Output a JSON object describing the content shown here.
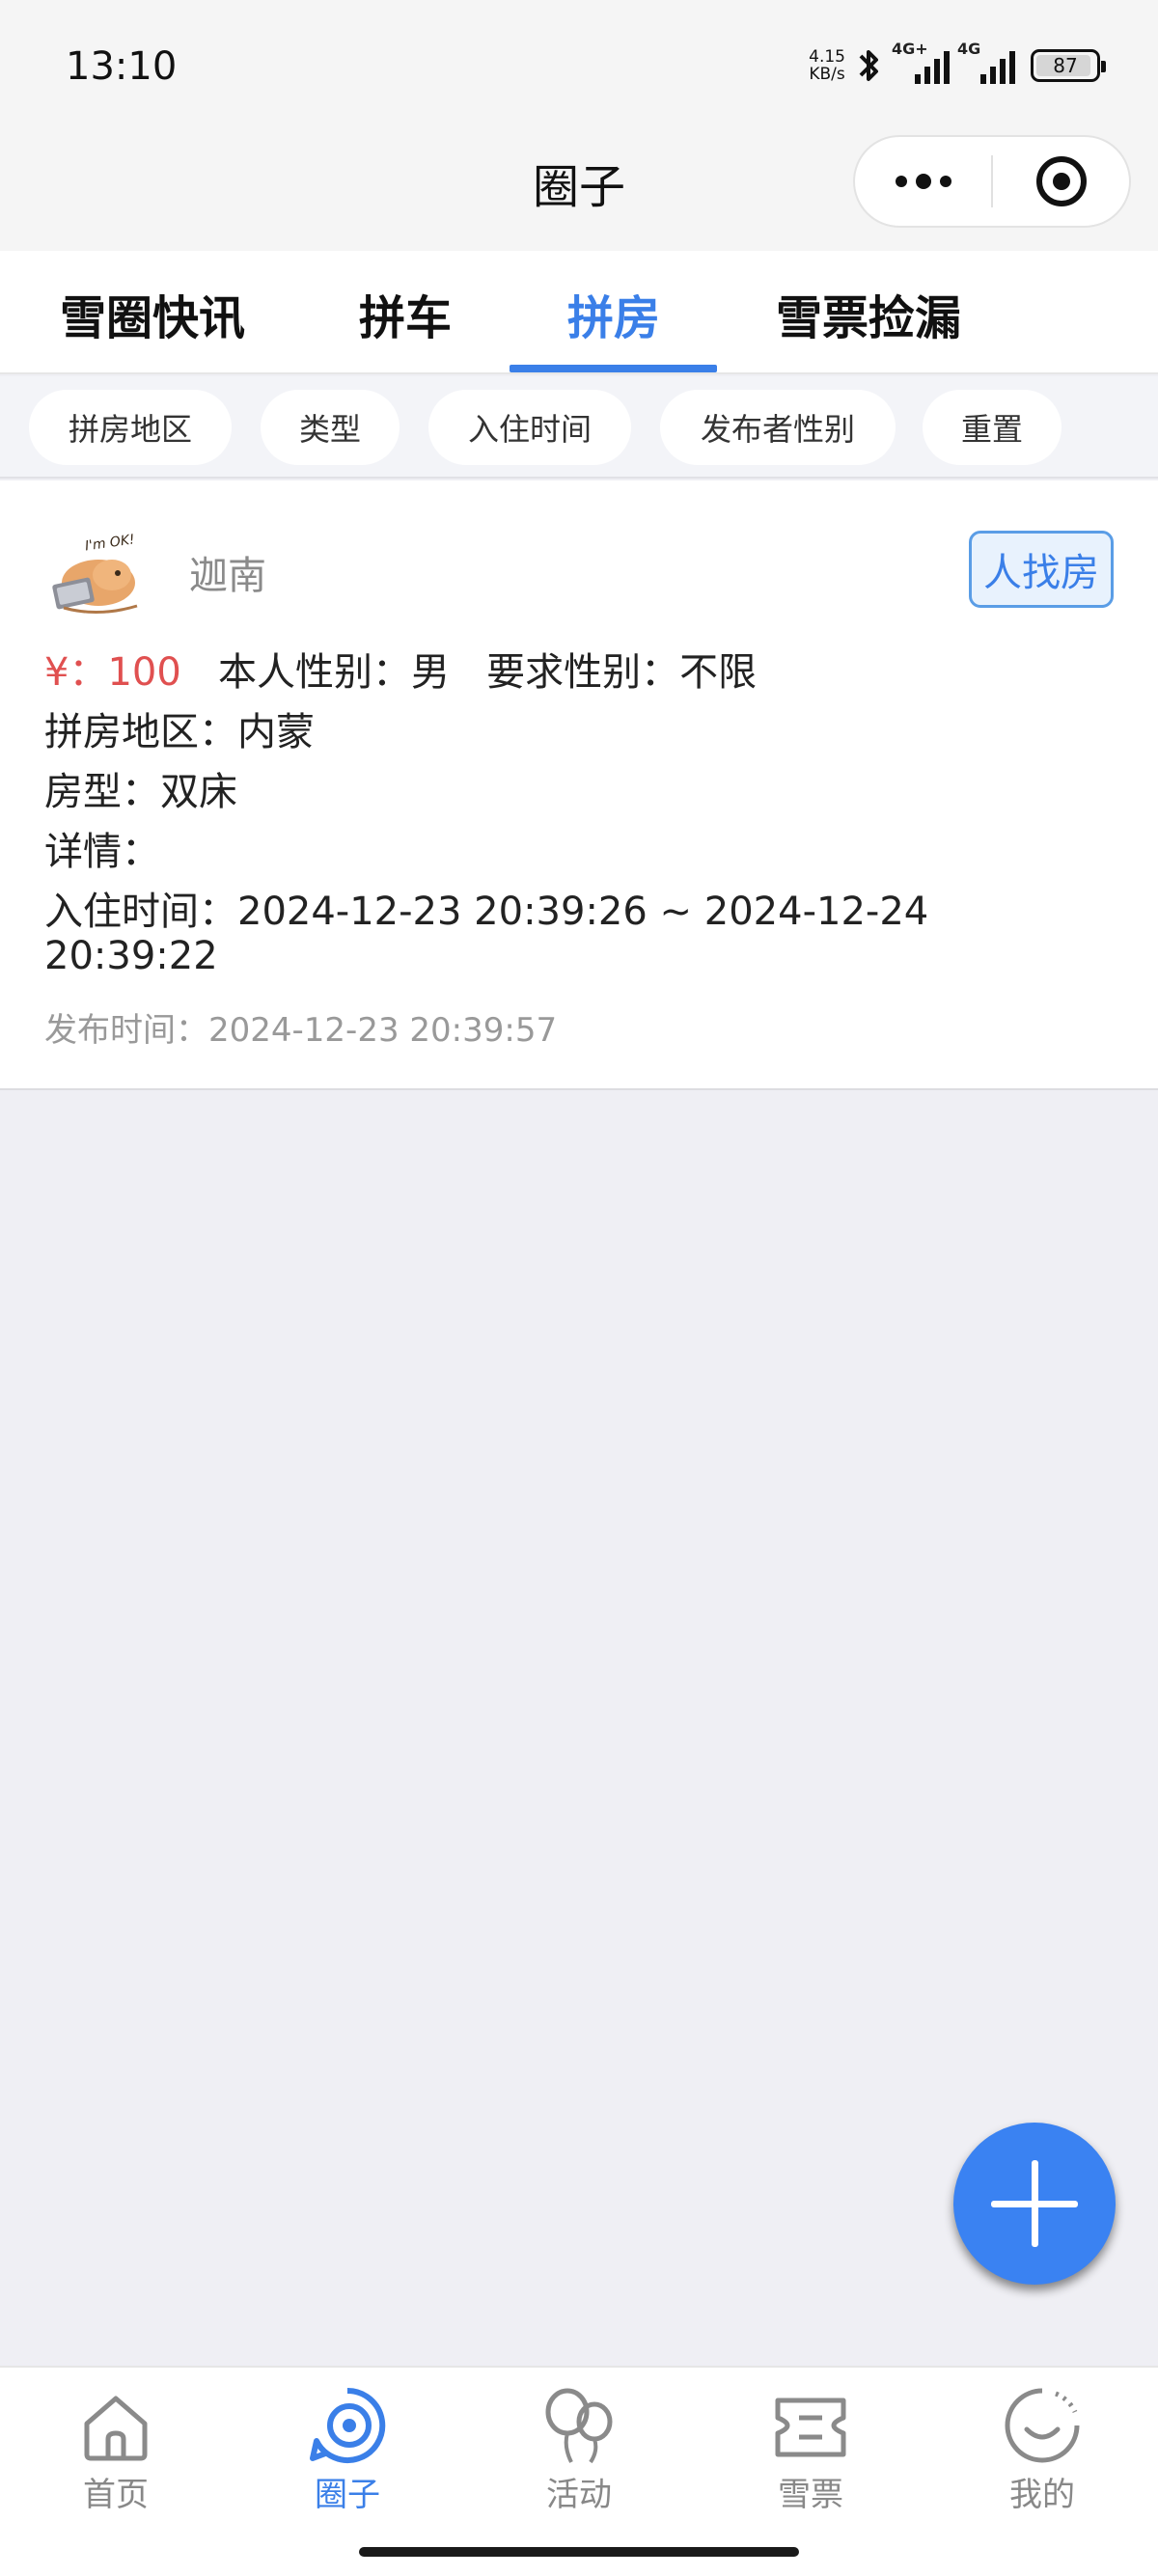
{
  "status_bar": {
    "time": "13:10",
    "net_speed_value": "4.15",
    "net_speed_unit": "KB/s",
    "network_1": "4G+",
    "network_2": "4G",
    "battery": "87"
  },
  "nav": {
    "title": "圈子"
  },
  "tabs": [
    {
      "label": "雪圈快讯",
      "active": false
    },
    {
      "label": "拼车",
      "active": false
    },
    {
      "label": "拼房",
      "active": true
    },
    {
      "label": "雪票捡漏",
      "active": false
    }
  ],
  "filters": [
    "拼房地区",
    "类型",
    "入住时间",
    "发布者性别",
    "重置"
  ],
  "post": {
    "username": "迦南",
    "avatar_text": "I'm OK!",
    "tag": "人找房",
    "price": "¥：100",
    "own_gender": "本人性别：男",
    "required_gender": "要求性别：不限",
    "region": "拼房地区：内蒙",
    "room_type": "房型：双床",
    "details": "详情：",
    "checkin_line1": "入住时间：2024-12-23 20:39:26 ~ 2024-12-24",
    "checkin_line2": "20:39:22",
    "published": "发布时间：2024-12-23 20:39:57"
  },
  "tabbar": [
    {
      "label": "首页",
      "icon": "home-icon",
      "active": false
    },
    {
      "label": "圈子",
      "icon": "circle-target-icon",
      "active": true
    },
    {
      "label": "活动",
      "icon": "balloons-icon",
      "active": false
    },
    {
      "label": "雪票",
      "icon": "ticket-icon",
      "active": false
    },
    {
      "label": "我的",
      "icon": "smile-face-icon",
      "active": false
    }
  ],
  "colors": {
    "accent": "#3a7fe8",
    "price": "#e05050",
    "fab": "#3a82f2",
    "background": "#efeff4"
  }
}
